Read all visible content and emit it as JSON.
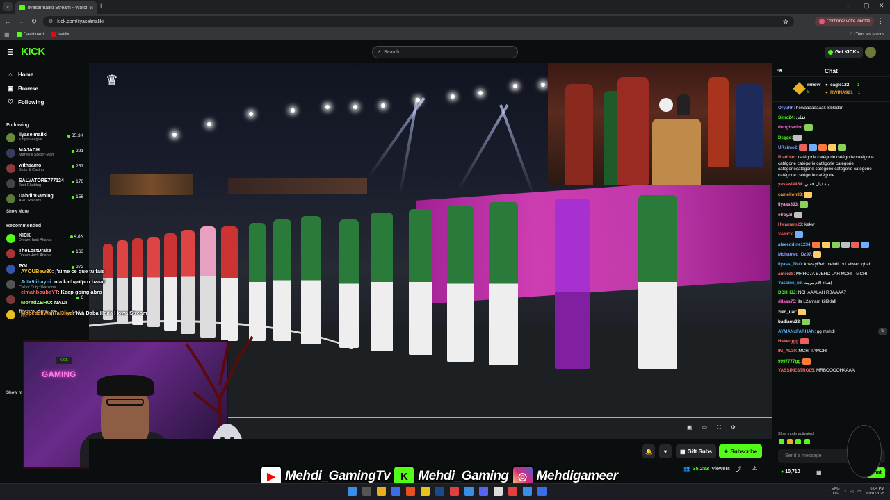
{
  "browser": {
    "tab_title": "ilyaselmaliki Stream - Watch Li",
    "url": "kick.com/ilyaselmaliki",
    "identity_label": "Confirmer votre identité",
    "bookmarks": [
      "Dashboard",
      "Netflix"
    ],
    "all_bookmarks": "Tous les favoris"
  },
  "header": {
    "logo": "KICK",
    "search_placeholder": "Search",
    "get_kicks": "Get KICKs"
  },
  "sidebar": {
    "nav": [
      "Home",
      "Browse",
      "Following"
    ],
    "following_title": "Following",
    "following": [
      {
        "name": "ilyaselmaliki",
        "category": "Kings League",
        "viewers": "35.3K",
        "color": "#6a8a3a"
      },
      {
        "name": "MAJACH",
        "category": "Marvel's Spider-Man",
        "viewers": "291",
        "color": "#3a3a5a"
      },
      {
        "name": "withsamo",
        "category": "Slots & Casino",
        "viewers": "257",
        "color": "#8a3a3a"
      },
      {
        "name": "SALVATORE777124",
        "category": "Just Chatting",
        "viewers": "176",
        "color": "#444"
      },
      {
        "name": "DahdihGaming",
        "category": "ARC Raiders",
        "viewers": "156",
        "color": "#5a7a3a"
      }
    ],
    "show_more": "Show More",
    "recommended_title": "Recommended",
    "recommended": [
      {
        "name": "KICK",
        "category": "DreamHack Atlanta",
        "viewers": "4.8K",
        "color": "#53fc18"
      },
      {
        "name": "TheLostDrake",
        "category": "DreamHack Atlanta",
        "viewers": "163",
        "color": "#aa3333"
      },
      {
        "name": "PGL",
        "category": "",
        "viewers": "272",
        "color": "#3355aa"
      }
    ],
    "extra_rows": [
      {
        "category": "Call of Duty: Warzone",
        "viewers": "63"
      },
      {
        "category": "DreamHack Atlanta",
        "viewers": "6"
      },
      {
        "name": "fissure_dota_en",
        "category": "Dota 2",
        "viewers": "14.8K"
      }
    ],
    "show_more_2": "Show m"
  },
  "overlay_chat": [
    {
      "user": "AYOUBew30",
      "text": ": j'aime ce que tu fais",
      "color": "#ffcc33"
    },
    {
      "user": "Jdtx9lihayni",
      "text": ": nta katban pro bzaaf",
      "color": "#66ccff"
    },
    {
      "user": "elmahboubaYT",
      "text": ": Keep going abro",
      "color": "#ff6666"
    },
    {
      "user": "MoradZERO",
      "text": ": NADI",
      "color": "#99ff66"
    },
    {
      "user": "MobedekWajiTal3liya",
      "text": ": Iwa Daba Hada Howa Stream",
      "color": "#ffaa44"
    }
  ],
  "player": {
    "gift_subs": "Gift Subs",
    "subscribe": "Subscribe",
    "viewers": "35,283",
    "viewers_label": "Viewers"
  },
  "socials": [
    {
      "name": "Mehdi_GamingTv",
      "icon": "youtube-icon",
      "color": "#ff0000"
    },
    {
      "name": "Mehdi_Gaming",
      "icon": "kick-icon",
      "color": "#53fc18"
    },
    {
      "name": "Mehdigameer",
      "icon": "instagram-icon",
      "color": "#d62976"
    }
  ],
  "chat": {
    "title": "Chat",
    "leaderboard": [
      {
        "name": "mnsvr",
        "count": "5"
      },
      {
        "name": "eagle122",
        "count": "1"
      },
      {
        "name": "RWINA921",
        "count": "1"
      }
    ],
    "messages": [
      {
        "user": "Oryuhh",
        "text": ": hewaaaaaaaak lebledar",
        "color": "#8a9cff"
      },
      {
        "user": "Simo24",
        "text": ": فقلي",
        "color": "#53fc18"
      },
      {
        "user": "dnoghwdnc",
        "text": ":",
        "color": "#ff6bd5",
        "emotes": 1
      },
      {
        "user": "Dsggd",
        "text": ":",
        "color": "#53fc18",
        "emotes": 1
      },
      {
        "user": "URsimo2",
        "text": ":",
        "color": "#8a9cff",
        "emotes": 5
      },
      {
        "user": "Riadriad",
        "text": ": catégorie catégorie catégorie catégorie catégorie catégorie catégorie catégorie catégoriecatégorie catégorie catégorie catégorie catégorie catégorie catégorie",
        "color": "#ff6b6b"
      },
      {
        "user": "yasswi4454",
        "text": ": لبنة ديال فقلي",
        "color": "#ff6b6b"
      },
      {
        "user": "camellon33",
        "text": ":",
        "color": "#ff9b3a",
        "emotes": 1
      },
      {
        "user": "Iiyaas333",
        "text": ":",
        "color": "#ff9bd5",
        "emotes": 1
      },
      {
        "user": "elroyal",
        "text": ":",
        "color": "#ff9bd5",
        "emotes": 1
      },
      {
        "user": "Hwamam23",
        "text": ": kekw",
        "color": "#ff6b6b"
      },
      {
        "user": "VANEX",
        "text": ":",
        "color": "#ff5a5a",
        "emotes": 1
      },
      {
        "user": "alaeeddine1234",
        "text": ":",
        "color": "#5ab4ff",
        "emotes": 6
      },
      {
        "user": "Mohamed_Dz97",
        "text": ":",
        "color": "#8a9cff",
        "emotes": 1
      },
      {
        "user": "Ilyass_TNO",
        "text": ": khas yl3eb mehdi 1v1 alwad lqhab",
        "color": "#5ab4ff"
      },
      {
        "user": "amerd8",
        "text": ": MRHO7A BJEHD LAH MCHI TMCHI",
        "color": "#ff6b6b"
      },
      {
        "user": "Yassine_uz",
        "text": ": إهداء الأم مريبه",
        "color": "#5ab4ff"
      },
      {
        "user": "DDHHJJ",
        "text": ": NCHAAALAH RBAAAA7",
        "color": "#53fc18"
      },
      {
        "user": "dilass75",
        "text": ": lla L2amam kill9dafi",
        "color": "#ff6bd5"
      },
      {
        "user": "ziko_uar",
        "text": ":",
        "color": "#ffffff",
        "emotes": 1
      },
      {
        "user": "badiaou23",
        "text": ":",
        "color": "#ffffff",
        "emotes": 1
      },
      {
        "user": "AYMANxFARHAN",
        "text": ": gg mehdi",
        "color": "#5ab4ff"
      },
      {
        "user": "Hakerggg",
        "text": ":",
        "color": "#ff6b6b",
        "emotes": 1
      },
      {
        "user": "IM_AL30",
        "text": ": MCHI TAMCHI",
        "color": "#ff6b6b"
      },
      {
        "user": "9997777gg",
        "text": ":",
        "color": "#53fc18",
        "emotes": 1
      },
      {
        "user": "YASSINESTRO05",
        "text": ": MRBOOOOHAAAA",
        "color": "#ff6b6b"
      }
    ],
    "slow_mode": "Slow mode activated",
    "input_placeholder": "Send a message",
    "kicks_balance": "10,710",
    "send_label": "Chat"
  },
  "taskbar": {
    "lang": "ENG",
    "region": "US",
    "time": "6:04 PM",
    "date": "10/31/2025"
  }
}
